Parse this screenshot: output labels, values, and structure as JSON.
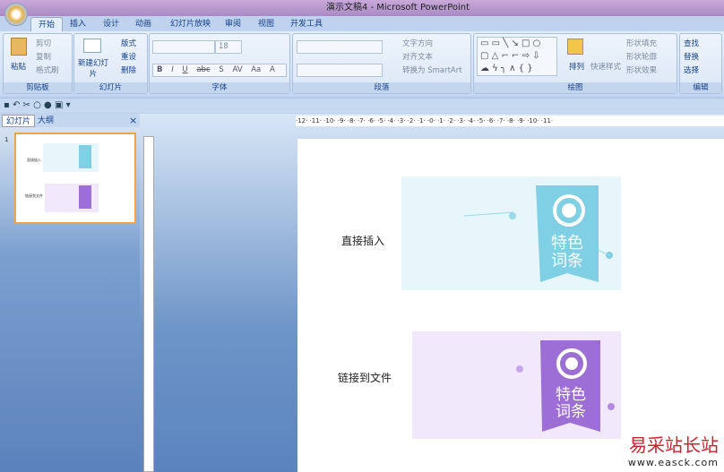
{
  "window": {
    "title": "演示文稿4 - Microsoft PowerPoint"
  },
  "tabs": [
    "开始",
    "插入",
    "设计",
    "动画",
    "幻灯片放映",
    "审阅",
    "视图",
    "开发工具"
  ],
  "ribbon": {
    "clipboard": {
      "label": "剪贴板",
      "paste": "粘贴",
      "cut": "剪切",
      "copy": "复制",
      "format_painter": "格式刷"
    },
    "slides": {
      "label": "幻灯片",
      "new_slide": "新建幻灯片",
      "layout": "版式",
      "reset": "重设",
      "delete": "删除"
    },
    "font": {
      "label": "字体",
      "font_name": "",
      "font_size": "18",
      "buttons": [
        "B",
        "I",
        "U",
        "abc",
        "S",
        "AV",
        "Aa",
        "A"
      ]
    },
    "paragraph": {
      "label": "段落",
      "text_direction": "文字方向",
      "align_text": "对齐文本",
      "convert_smartart": "转换为 SmartArt"
    },
    "drawing": {
      "label": "绘图",
      "arrange": "排列",
      "quick_styles": "快速样式",
      "shape_fill": "形状填充",
      "shape_outline": "形状轮廓",
      "shape_effects": "形状效果"
    },
    "editing": {
      "label": "编辑",
      "find": "查找",
      "replace": "替换",
      "select": "选择"
    }
  },
  "panel": {
    "tabs": [
      "幻灯片",
      "大纲"
    ],
    "slide_number": "1",
    "close": "×"
  },
  "ruler": "·12· ·11· ·10· ·9· ·8· ·7· ·6· ·5· ·4· ·3· ·2· ·1· ·0· ·1· ·2· ·3· ·4· ·5· ·6· ·7· ·8· ·9· ·10· ·11·",
  "slide": {
    "item1": {
      "label": "直接插入",
      "banner_text": [
        "特色",
        "词条"
      ],
      "bg": "#e6f6fb",
      "color": "#7fd0e4"
    },
    "item2": {
      "label": "链接到文件",
      "banner_text": [
        "特色",
        "词条"
      ],
      "bg": "#f2e8fb",
      "color": "#9c6ed6"
    }
  },
  "watermark": {
    "name": "易采站长站",
    "url": "www.easck.com"
  }
}
